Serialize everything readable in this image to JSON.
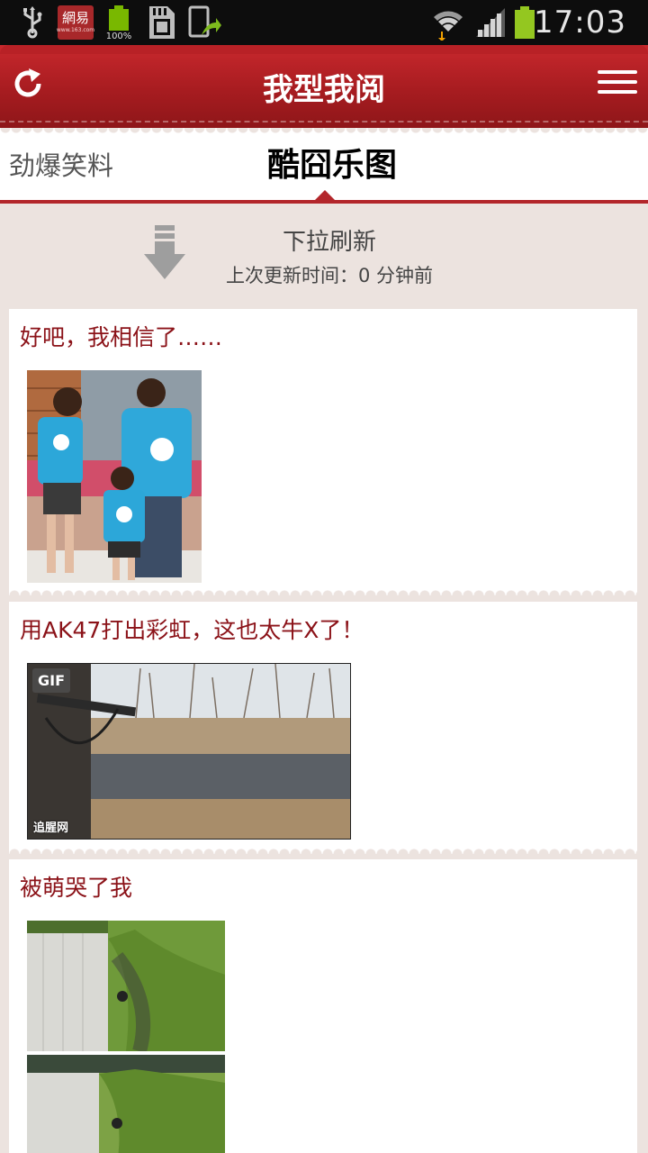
{
  "status_bar": {
    "time": "17:03",
    "netease_label": "網易",
    "battery_percent_label": "100%",
    "icons": [
      "usb-icon",
      "netease-news-icon",
      "battery-full-icon",
      "sd-card-icon",
      "app-update-icon",
      "wifi-icon",
      "signal-icon",
      "battery-icon"
    ],
    "battery_level": 1.0
  },
  "header": {
    "title": "我型我阅",
    "refresh_icon": "refresh-icon",
    "menu_icon": "menu-icon"
  },
  "tabs": [
    {
      "label": "劲爆笑料",
      "active": false
    },
    {
      "label": "酷囧乐图",
      "active": true
    }
  ],
  "pull_refresh": {
    "title": "下拉刷新",
    "last_update": "上次更新时间：0 分钟前"
  },
  "posts": [
    {
      "title": "好吧，我相信了……"
    },
    {
      "title": "用AK47打出彩虹，这也太牛X了！",
      "badge": "GIF",
      "watermark": "追腥网"
    },
    {
      "title": "被萌哭了我"
    }
  ],
  "colors": {
    "accent": "#b3262b",
    "title_red": "#8b1218",
    "background": "#ece3df"
  }
}
